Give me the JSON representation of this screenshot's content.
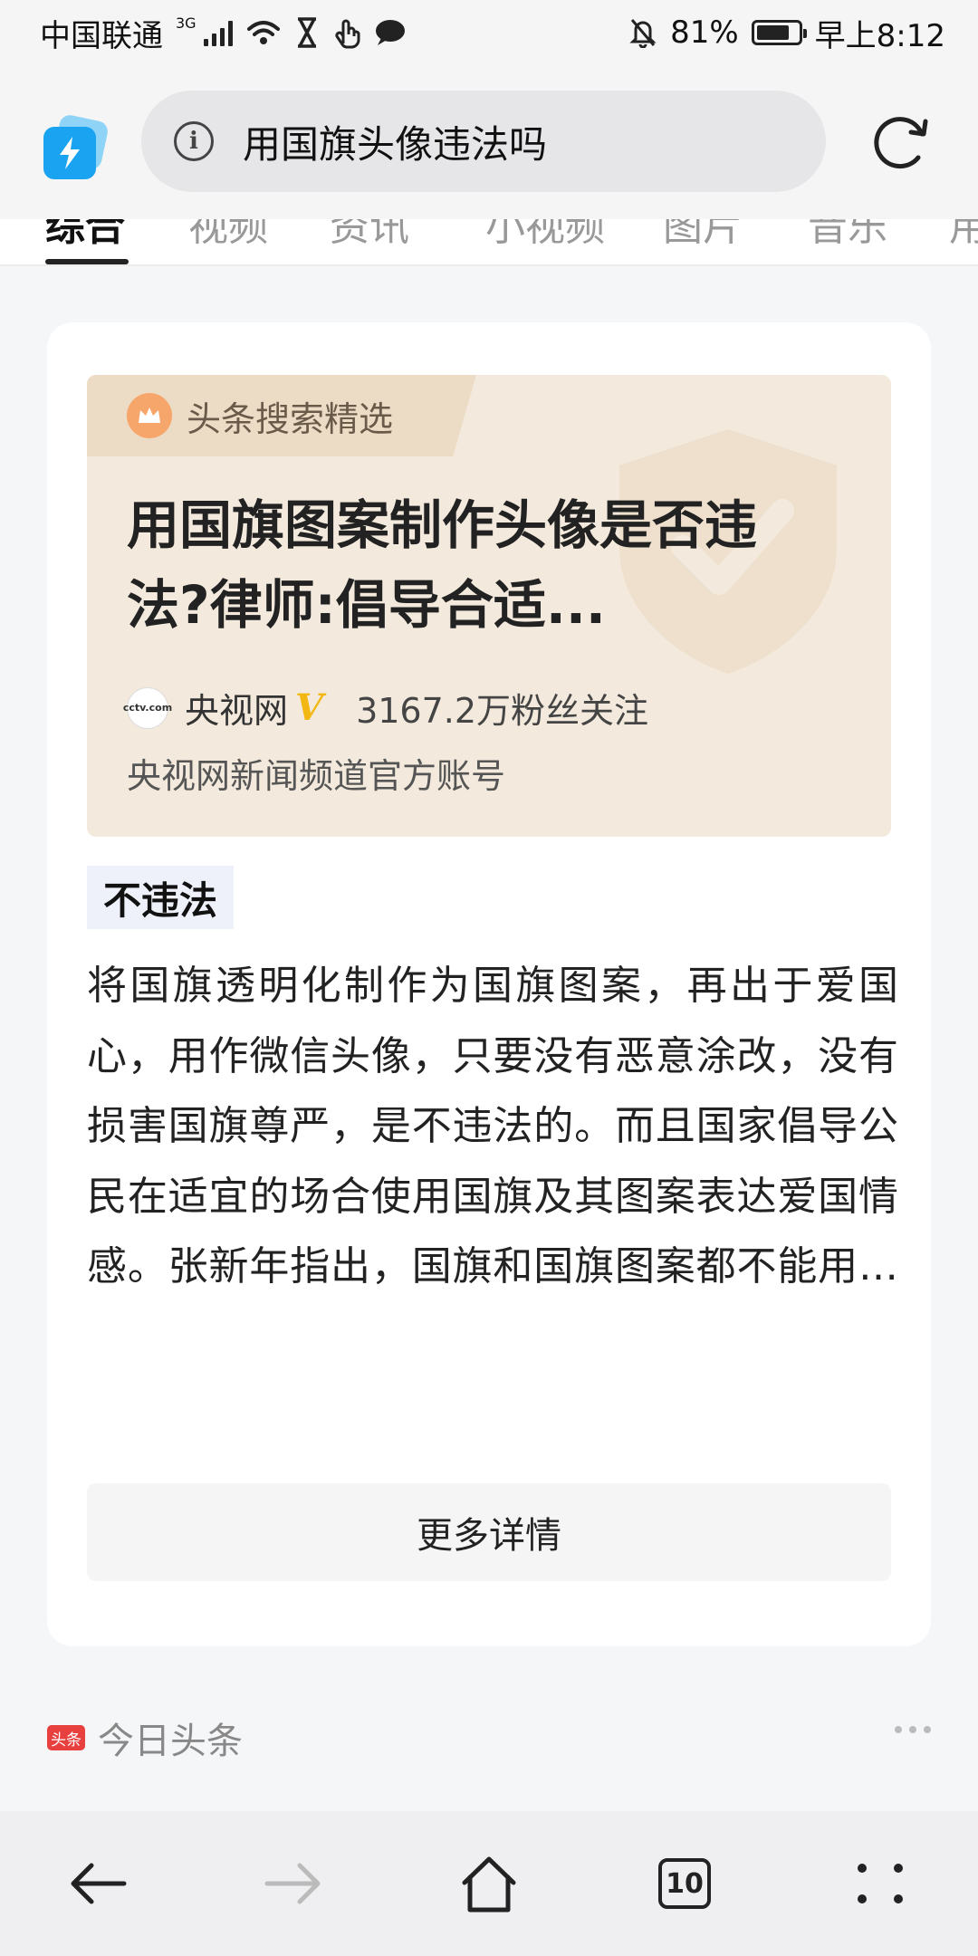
{
  "status_bar": {
    "carrier": "中国联通",
    "network": "3G",
    "battery": "81%",
    "battery_level": 0.81,
    "time": "早上8:12"
  },
  "address_bar": {
    "url_text": "用国旗头像违法吗",
    "info_icon": "info-icon",
    "refresh_icon": "refresh-icon"
  },
  "tabs": [
    {
      "label": "综合",
      "active": true
    },
    {
      "label": "视频",
      "active": false
    },
    {
      "label": "资讯",
      "active": false
    },
    {
      "label": "小视频",
      "active": false
    },
    {
      "label": "图片",
      "active": false
    },
    {
      "label": "音乐",
      "active": false
    },
    {
      "label": "用",
      "active": false
    }
  ],
  "card": {
    "badge_label": "头条搜索精选",
    "title": "用国旗图案制作头像是否违法?律师:倡导合适...",
    "source": {
      "avatar_label": "cctv.com",
      "name": "央视网",
      "verified": "V",
      "followers": "3167.2万粉丝关注",
      "description": "央视网新闻频道官方账号"
    },
    "answer_tag": "不违法",
    "answer_body": "将国旗透明化制作为国旗图案，再出于爱国心，用作微信头像，只要没有恶意涂改，没有损害国旗尊严，是不违法的。而且国家倡导公民在适宜的场合使用国旗及其图案表达爱国情感。张新年指出，国旗和国旗图案都不能用于商业用途，比如将企业的标识与国旗图案组合，利用国旗图案做广告等。",
    "more_button": "更多详情"
  },
  "footer_source": {
    "logo_label": "头条",
    "name": "今日头条"
  },
  "bottom_nav": {
    "tab_count": "10"
  },
  "colors": {
    "accent_blue": "#1aa3f0",
    "banner_bg": "#f3eadd",
    "verified_gold": "#f2b713",
    "toutiao_red": "#e8403f"
  }
}
